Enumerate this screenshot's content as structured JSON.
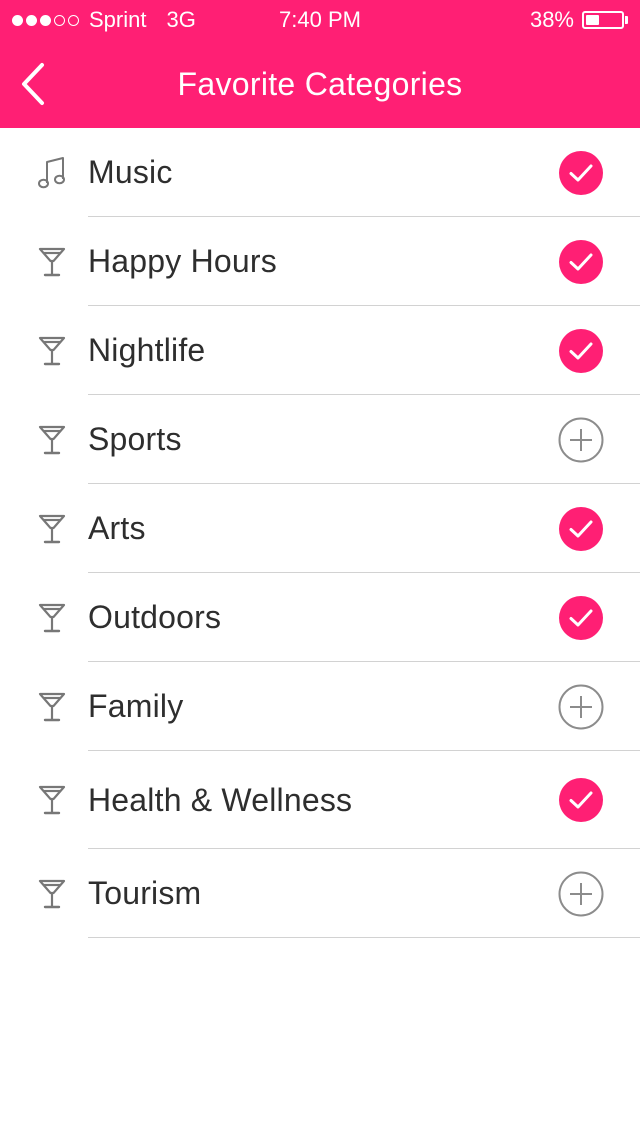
{
  "status_bar": {
    "carrier": "Sprint",
    "network": "3G",
    "time": "7:40 PM",
    "battery_percent": "38%",
    "battery_level": 0.38,
    "signal_bars": 3,
    "signal_max": 5
  },
  "nav": {
    "title": "Favorite Categories",
    "back_icon": "chevron-left-icon"
  },
  "colors": {
    "accent": "#ff1f74",
    "text": "#2e2e2e",
    "icon_gray": "#777777",
    "divider": "#d2d2d2"
  },
  "categories": [
    {
      "label": "Music",
      "icon": "music-note-icon",
      "selected": true
    },
    {
      "label": "Happy Hours",
      "icon": "cocktail-glass-icon",
      "selected": true
    },
    {
      "label": "Nightlife",
      "icon": "cocktail-glass-icon",
      "selected": true
    },
    {
      "label": "Sports",
      "icon": "cocktail-glass-icon",
      "selected": false
    },
    {
      "label": "Arts",
      "icon": "cocktail-glass-icon",
      "selected": true
    },
    {
      "label": "Outdoors",
      "icon": "cocktail-glass-icon",
      "selected": true
    },
    {
      "label": "Family",
      "icon": "cocktail-glass-icon",
      "selected": false
    },
    {
      "label": "Health & Wellness",
      "icon": "cocktail-glass-icon",
      "selected": true
    },
    {
      "label": "Tourism",
      "icon": "cocktail-glass-icon",
      "selected": false
    }
  ]
}
